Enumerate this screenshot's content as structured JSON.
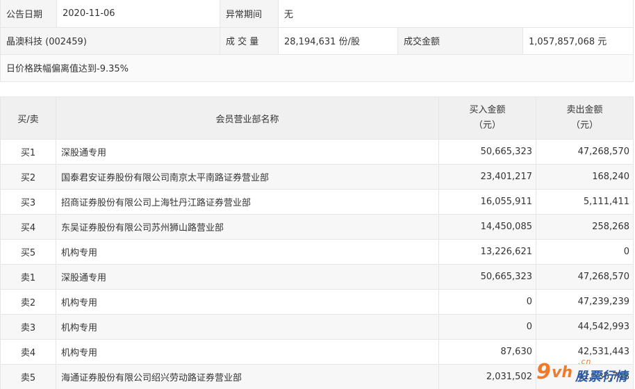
{
  "info": {
    "announce_date_label": "公告日期",
    "announce_date": "2020-11-06",
    "abnormal_period_label": "异常期间",
    "abnormal_period": "无",
    "stock": "晶澳科技 (002459)",
    "volume_label": "成 交 量",
    "volume": "28,194,631 份/股",
    "amount_label": "成交金额",
    "amount": "1,057,857,068 元",
    "reason": "日价格跌幅偏离值达到-9.35%"
  },
  "table": {
    "headers": {
      "side": "买/卖",
      "name": "会员营业部名称",
      "buy_line1": "买入金额",
      "buy_line2": "（元）",
      "sell_line1": "卖出金额",
      "sell_line2": "（元）"
    },
    "rows": [
      {
        "side": "买1",
        "name": "深股通专用",
        "buy": "50,665,323",
        "sell": "47,268,570"
      },
      {
        "side": "买2",
        "name": "国泰君安证券股份有限公司南京太平南路证券营业部",
        "buy": "23,401,217",
        "sell": "168,240"
      },
      {
        "side": "买3",
        "name": "招商证券股份有限公司上海牡丹江路证券营业部",
        "buy": "16,055,911",
        "sell": "5,111,411"
      },
      {
        "side": "买4",
        "name": "东吴证券股份有限公司苏州狮山路营业部",
        "buy": "14,450,085",
        "sell": "258,268"
      },
      {
        "side": "买5",
        "name": "机构专用",
        "buy": "13,226,621",
        "sell": "0"
      },
      {
        "side": "卖1",
        "name": "深股通专用",
        "buy": "50,665,323",
        "sell": "47,268,570"
      },
      {
        "side": "卖2",
        "name": "机构专用",
        "buy": "0",
        "sell": "47,239,239"
      },
      {
        "side": "卖3",
        "name": "机构专用",
        "buy": "0",
        "sell": "44,542,993"
      },
      {
        "side": "卖4",
        "name": "机构专用",
        "buy": "87,630",
        "sell": "42,531,443"
      },
      {
        "side": "卖5",
        "name": "海通证券股份有限公司绍兴劳动路证券营业部",
        "buy": "2,031,502",
        "sell": "41,536,748"
      }
    ]
  },
  "watermark": {
    "nine": "9",
    "vh": "vh",
    "dotcn": ".cn",
    "brand": "股票行情",
    "colors": {
      "orange": "#f07a2a",
      "blue": "#2b5aa8"
    }
  }
}
